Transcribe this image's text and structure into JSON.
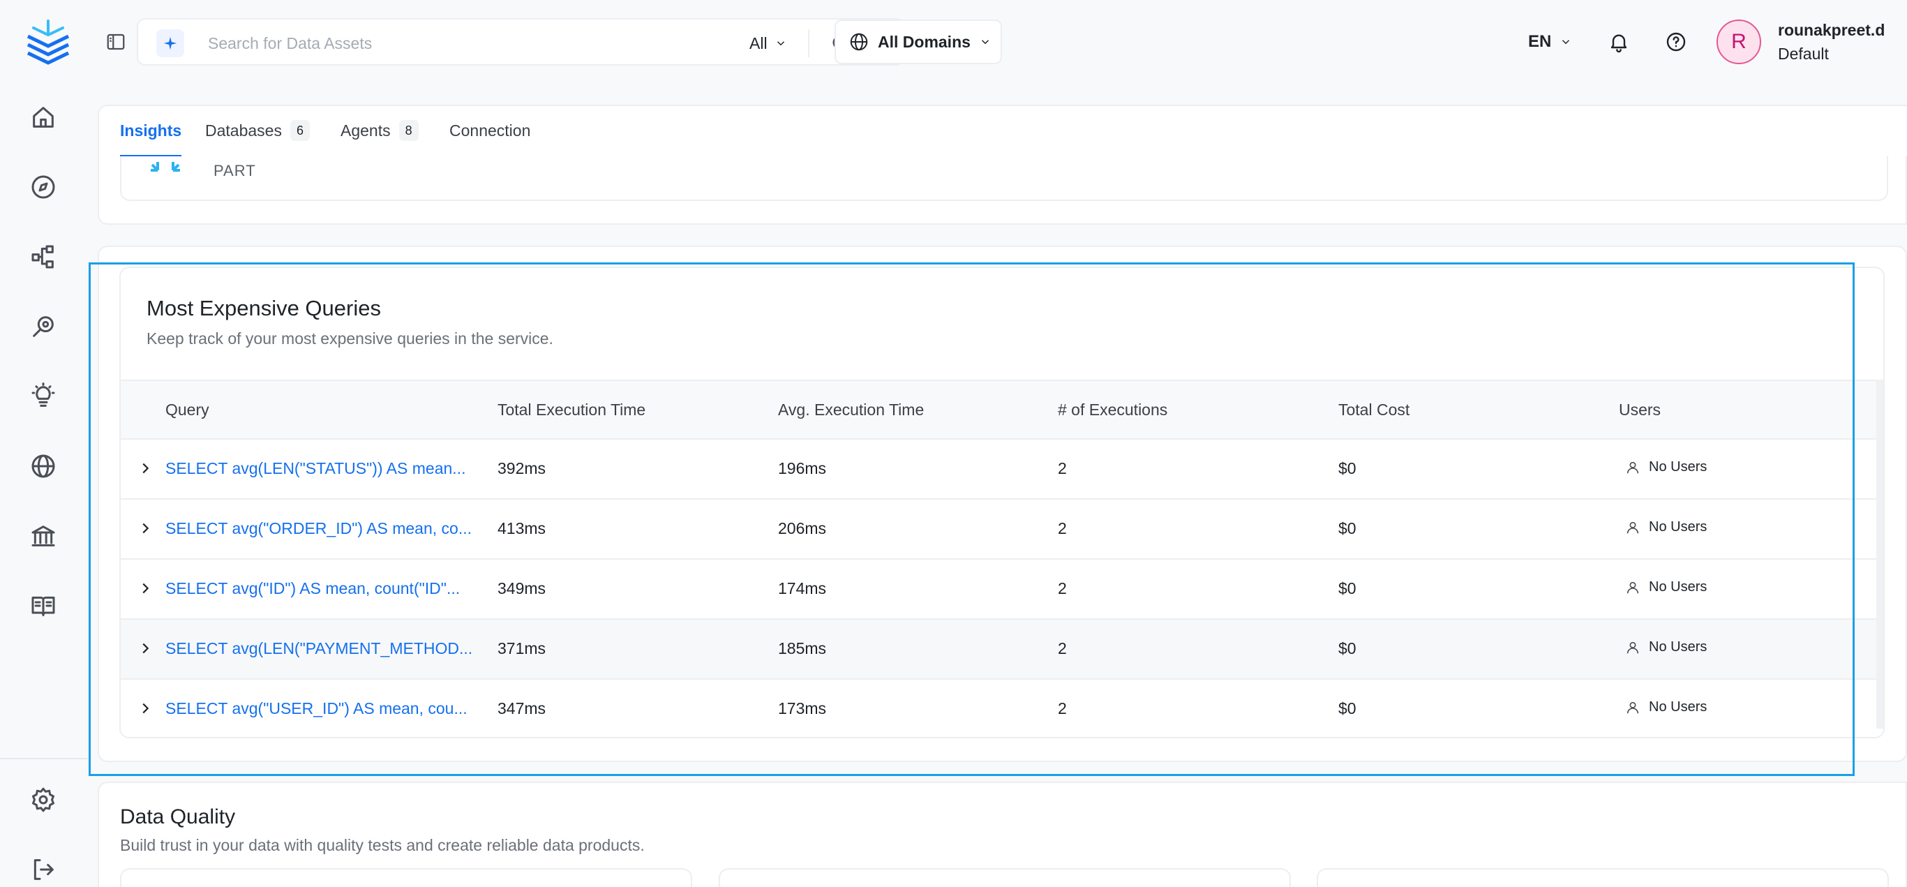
{
  "rail": {
    "items": [
      {
        "name": "home-icon"
      },
      {
        "name": "explore-icon"
      },
      {
        "name": "lineage-icon"
      },
      {
        "name": "observability-icon"
      },
      {
        "name": "insights-icon"
      },
      {
        "name": "domains-icon"
      },
      {
        "name": "governance-icon"
      },
      {
        "name": "glossary-icon"
      }
    ],
    "bottom": [
      {
        "name": "settings-icon"
      },
      {
        "name": "logout-icon"
      }
    ]
  },
  "search": {
    "placeholder": "Search for Data Assets",
    "scope": "All"
  },
  "domains": {
    "label": "All Domains"
  },
  "language": "EN",
  "user": {
    "initial": "R",
    "name": "rounakpreet.d",
    "role": "Default"
  },
  "tabs": [
    {
      "label": "Insights",
      "active": true
    },
    {
      "label": "Databases",
      "count": "6"
    },
    {
      "label": "Agents",
      "count": "8"
    },
    {
      "label": "Connection"
    }
  ],
  "previous_card": {
    "label": "PART"
  },
  "expensive_queries": {
    "title": "Most Expensive Queries",
    "subtitle": "Keep track of your most expensive queries in the service.",
    "columns": [
      "Query",
      "Total Execution Time",
      "Avg. Execution Time",
      "# of Executions",
      "Total Cost",
      "Users"
    ],
    "rows": [
      {
        "query": "SELECT avg(LEN(\"STATUS\")) AS mean...",
        "total_time": "392ms",
        "avg_time": "196ms",
        "executions": "2",
        "cost": "$0",
        "users": "No Users"
      },
      {
        "query": "SELECT avg(\"ORDER_ID\") AS mean, co...",
        "total_time": "413ms",
        "avg_time": "206ms",
        "executions": "2",
        "cost": "$0",
        "users": "No Users"
      },
      {
        "query": "SELECT avg(\"ID\") AS mean, count(\"ID\"...",
        "total_time": "349ms",
        "avg_time": "174ms",
        "executions": "2",
        "cost": "$0",
        "users": "No Users"
      },
      {
        "query": "SELECT avg(LEN(\"PAYMENT_METHOD...",
        "total_time": "371ms",
        "avg_time": "185ms",
        "executions": "2",
        "cost": "$0",
        "users": "No Users"
      },
      {
        "query": "SELECT avg(\"USER_ID\") AS mean, cou...",
        "total_time": "347ms",
        "avg_time": "173ms",
        "executions": "2",
        "cost": "$0",
        "users": "No Users"
      }
    ]
  },
  "data_quality": {
    "title": "Data Quality",
    "subtitle": "Build trust in your data with quality tests and create reliable data products."
  },
  "colors": {
    "accent": "#1570ef",
    "focus": "#1a9fe8",
    "avatar_bg": "#fde2ee",
    "avatar_text": "#c11574"
  }
}
